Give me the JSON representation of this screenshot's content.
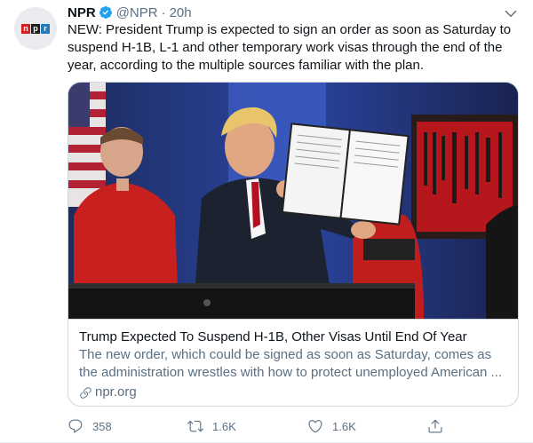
{
  "tweet": {
    "author_name": "NPR",
    "handle": "@NPR",
    "separator": "·",
    "time": "20h",
    "text": "NEW: President Trump is expected to sign an order as soon as Saturday to suspend H-1B, L-1 and other temporary work visas through the end of the year, according to the multiple sources familiar with the plan.",
    "avatar_logo": [
      "n",
      "p",
      "r"
    ]
  },
  "card": {
    "title": "Trump Expected To Suspend H-1B, Other Visas Until End Of Year",
    "description": "The new order, which could be signed as soon as Saturday, comes as the administration wrestles with how to protect unemployed American ...",
    "domain": "npr.org"
  },
  "actions": {
    "replies": "358",
    "retweets": "1.6K",
    "likes": "1.6K"
  },
  "icons": {
    "verified": "verified-badge-icon",
    "menu": "chevron-down-icon",
    "link": "link-icon",
    "reply": "reply-icon",
    "retweet": "retweet-icon",
    "like": "heart-icon",
    "share": "share-icon"
  },
  "colors": {
    "accent": "#1da1f2",
    "secondary_text": "#5b7083",
    "border": "#cfd9de"
  }
}
